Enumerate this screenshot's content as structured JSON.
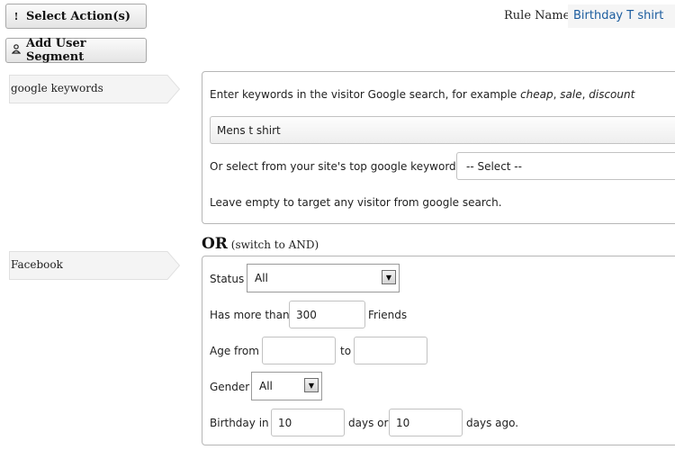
{
  "toolbar": {
    "select_actions_label": "Select Action(s)",
    "add_segment_label": "Add User Segment"
  },
  "rule": {
    "label": "Rule Name:",
    "value": "Birthday T shirt"
  },
  "google": {
    "tag_label": "google keywords",
    "intro_prefix": "Enter keywords in the visitor Google search, for example ",
    "example_1": "cheap",
    "example_2": "sale",
    "example_3": "discount",
    "keyword_value": "Mens t shirt",
    "select_prompt": "Or select from your site's top google keywords",
    "select_value": "-- Select --",
    "note": "Leave empty to target any visitor from google search."
  },
  "operator": {
    "label": "OR",
    "switch_label": "(switch to AND)"
  },
  "facebook": {
    "tag_label": "Facebook",
    "status_label": "Status",
    "status_value": "All",
    "friends_prefix": "Has more than",
    "friends_value": "300",
    "friends_suffix": "Friends",
    "age_label": "Age from",
    "age_from": "",
    "age_to_label": "to",
    "age_to": "",
    "gender_label": "Gender",
    "gender_value": "All",
    "birthday_label": "Birthday in",
    "birthday_from": "10",
    "birthday_mid": "days or",
    "birthday_to": "10",
    "birthday_suffix": "days ago."
  },
  "colors": {
    "link_blue": "#1b5c9e",
    "panel_border": "#b6b6b6"
  }
}
